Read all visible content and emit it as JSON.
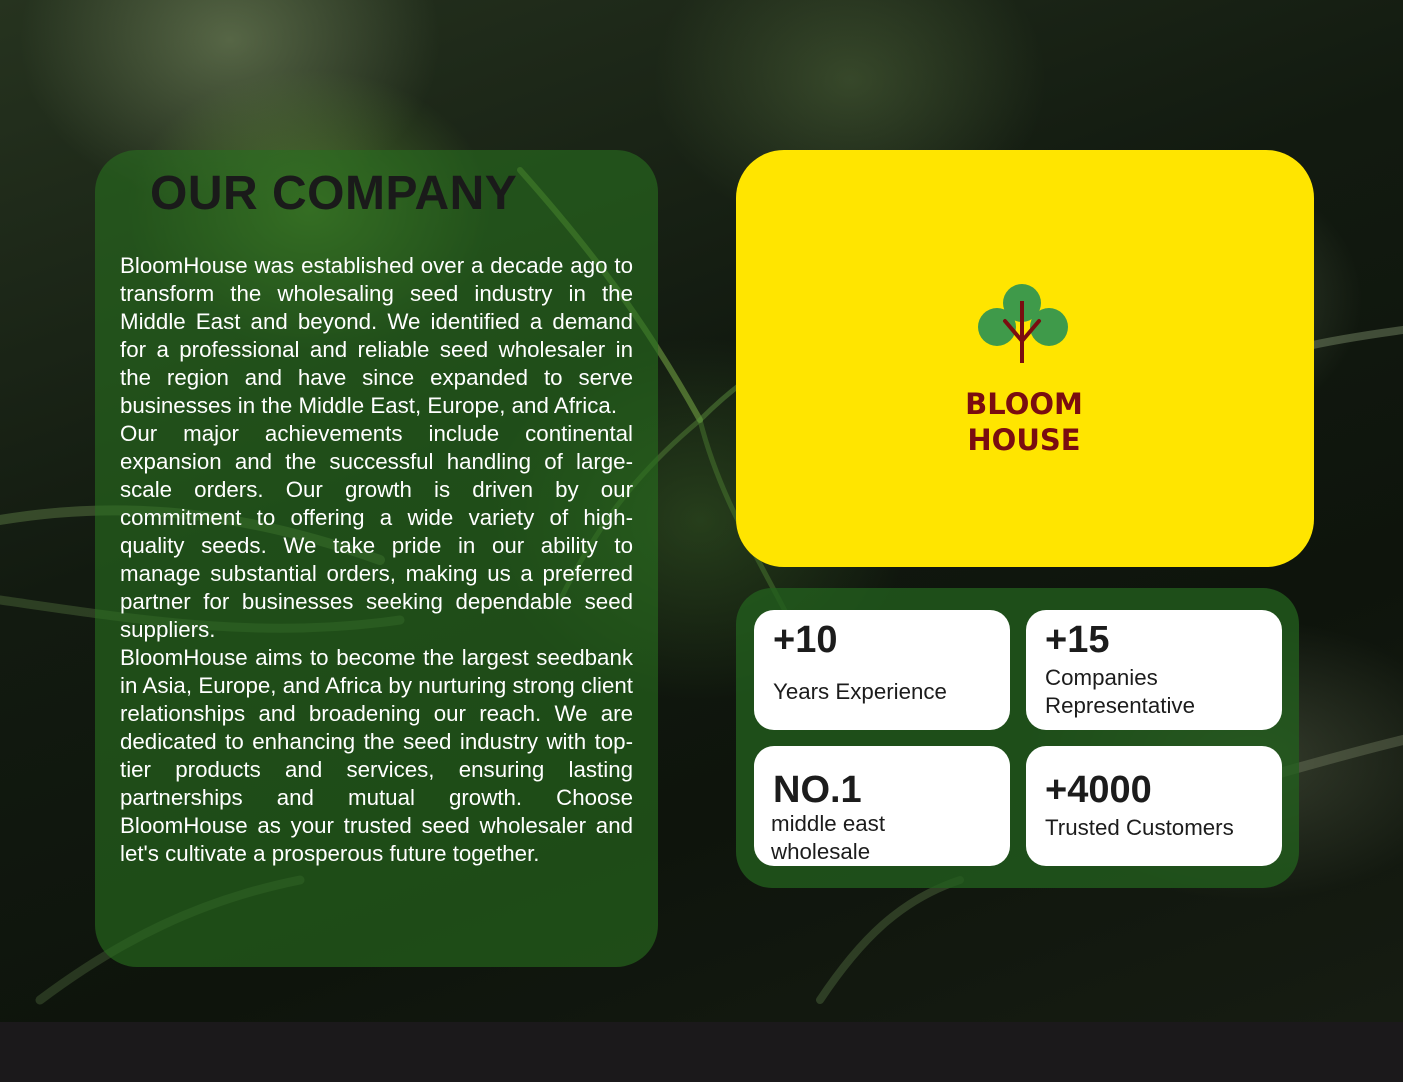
{
  "company": {
    "title": "OUR COMPANY",
    "paragraphs": [
      "BloomHouse was established over a decade ago to transform the wholesaling seed industry in the Middle East and beyond. We identified a demand for a professional and reliable seed wholesaler in the region and have since expanded to serve businesses in the Middle East, Europe, and Africa.",
      "Our major achievements include continental expansion and the successful handling of large-scale orders. Our growth is driven by our commitment to offering a wide variety of high-quality seeds. We take pride in our ability to manage substantial orders, making us a preferred partner for businesses seeking dependable seed suppliers.",
      "BloomHouse aims to become the largest seedbank in Asia, Europe, and Africa by nurturing strong client relationships and broadening our reach. We are dedicated to enhancing the seed industry with top-tier products and services, ensuring lasting partnerships and mutual growth. Choose BloomHouse as your trusted seed wholesaler and let's cultivate a prosperous future together."
    ]
  },
  "logo": {
    "line1": "BLOOM",
    "line2": "HOUSE",
    "icon": "tree-icon",
    "colors": {
      "background": "#ffe500",
      "text": "#7a0d10",
      "leaves": "#3f9a4a",
      "trunk": "#7a0d10"
    }
  },
  "stats": [
    {
      "value": "+10",
      "label": "Years Experience"
    },
    {
      "value": "+15",
      "label": "Companies Representative"
    },
    {
      "value": "NO.1",
      "label": "middle east wholesale"
    },
    {
      "value": "+4000",
      "label": "Trusted Customers"
    }
  ],
  "colors": {
    "card_green": "#2a6e1e",
    "title_text": "#1a1a1a",
    "footer": "#1b191b"
  }
}
